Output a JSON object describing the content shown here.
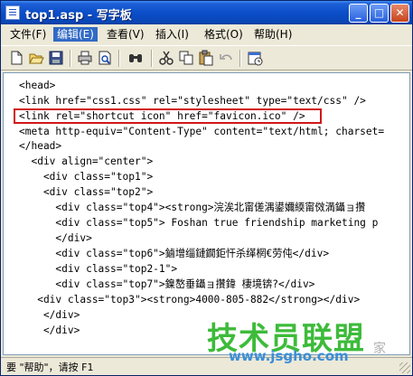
{
  "window": {
    "title": "top1.asp - 写字板",
    "controls": {
      "minimize": "_",
      "maximize": "□",
      "close": "✕"
    }
  },
  "menu": {
    "items": [
      {
        "label": "文件(F)"
      },
      {
        "label": "编辑(E)",
        "active": true
      },
      {
        "label": "查看(V)"
      },
      {
        "label": "插入(I)"
      },
      {
        "label": "格式(O)"
      },
      {
        "label": "帮助(H)"
      }
    ]
  },
  "toolbar": {
    "icons": [
      "new-icon",
      "open-icon",
      "save-icon",
      "print-icon",
      "print-preview-icon",
      "find-icon",
      "cut-icon",
      "copy-icon",
      "paste-icon",
      "undo-icon",
      "date-time-icon"
    ]
  },
  "editor": {
    "lines": [
      "<head>",
      "<link href=\"css1.css\" rel=\"stylesheet\" type=\"text/css\" />",
      "<link rel=\"shortcut icon\" href=\"favicon.ico\" />",
      "<meta http-equiv=\"Content-Type\" content=\"text/html; charset=",
      "</head>",
      "  <div align=\"center\">",
      "    <div class=\"top1\">",
      "    <div class=\"top2\">",
      "      <div class=\"top4\"><strong>浣涘北甯傞湡鍙嬭緛甯傚満鑷ョ攢",
      "      <div class=\"top5\"> Foshan true friendship marketing p",
      "      </div>",
      "      <div class=\"top6\">鏀增缁鏈鐗鉅忓杀缂棢€劳伅</div>",
      "      <div class=\"top2-1\">",
      "      <div class=\"top7\">鎳嶅垂鑷ョ攢鍏 棲境锛?</div>",
      "   <div class=\"top3\"><strong>4000-805-882</strong></div>",
      "    </div>",
      "    </div>"
    ],
    "highlighted_line": 2
  },
  "status": {
    "text": "要 \"帮助\"，请按 F1"
  },
  "watermark": {
    "main": "技术员联盟",
    "url": "www.jsgho.com",
    "side": "家"
  }
}
